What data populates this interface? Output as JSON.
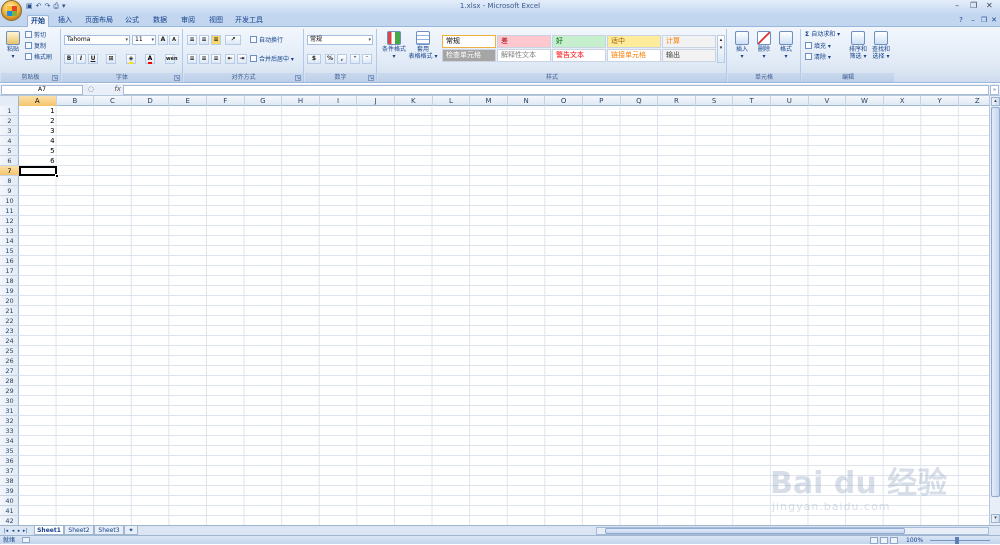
{
  "title_bar": {
    "window_title": "1.xlsx - Microsoft Excel",
    "qat": [
      "save-icon",
      "undo-icon",
      "redo-icon",
      "print-preview-icon",
      "customize-icon"
    ]
  },
  "tabs": [
    {
      "label": "开始",
      "active": true
    },
    {
      "label": "插入"
    },
    {
      "label": "页面布局"
    },
    {
      "label": "公式"
    },
    {
      "label": "数据"
    },
    {
      "label": "审阅"
    },
    {
      "label": "视图"
    },
    {
      "label": "开发工具"
    }
  ],
  "ribbon": {
    "clipboard": {
      "label": "剪贴板",
      "paste": "粘贴",
      "cut": "剪切",
      "copy": "复制",
      "format_painter": "格式刷"
    },
    "font": {
      "label": "字体",
      "font_name": "Tahoma",
      "font_size": "11",
      "grow": "A",
      "shrink": "A",
      "bold": "B",
      "italic": "I",
      "underline": "U",
      "font_color_letter": "A",
      "wen": "wén"
    },
    "alignment": {
      "label": "对齐方式",
      "wrap_text": "自动换行",
      "merge_center": "合并后居中"
    },
    "number": {
      "label": "数字",
      "format": "常规",
      "percent": "%",
      "comma": ","
    },
    "styles": {
      "label": "样式",
      "conditional": "条件格式",
      "table_format_1": "套用",
      "table_format_2": "表格格式",
      "cells": [
        {
          "text": "常规",
          "bg": "#ffffff",
          "color": "#000000",
          "border": "#f0b040"
        },
        {
          "text": "差",
          "bg": "#ffc7ce",
          "color": "#9c0006"
        },
        {
          "text": "好",
          "bg": "#c6efce",
          "color": "#006100"
        },
        {
          "text": "适中",
          "bg": "#ffeb9c",
          "color": "#9c6500"
        },
        {
          "text": "计算",
          "bg": "#f2f2f2",
          "color": "#fa7d00"
        },
        {
          "text": "检查单元格",
          "bg": "#a5a5a5",
          "color": "#ffffff"
        },
        {
          "text": "解释性文本",
          "bg": "#ffffff",
          "color": "#7f7f7f"
        },
        {
          "text": "警告文本",
          "bg": "#ffffff",
          "color": "#ff0000"
        },
        {
          "text": "链接单元格",
          "bg": "#ffffff",
          "color": "#fa7d00"
        },
        {
          "text": "输出",
          "bg": "#f2f2f2",
          "color": "#3f3f3f"
        }
      ]
    },
    "cells_group": {
      "label": "单元格",
      "insert": "插入",
      "delete": "删除",
      "format": "格式"
    },
    "editing": {
      "label": "编辑",
      "autosum": "自动求和",
      "fill": "填充",
      "clear": "清除",
      "sort_filter_1": "排序和",
      "sort_filter_2": "筛选",
      "find_select_1": "查找和",
      "find_select_2": "选择"
    }
  },
  "formula_bar": {
    "name_box": "A7",
    "fx": "fx",
    "value": ""
  },
  "grid": {
    "columns": [
      "A",
      "B",
      "C",
      "D",
      "E",
      "F",
      "G",
      "H",
      "I",
      "J",
      "K",
      "L",
      "M",
      "N",
      "O",
      "P",
      "Q",
      "R",
      "S",
      "T",
      "U",
      "V",
      "W",
      "X",
      "Y",
      "Z"
    ],
    "rows": [
      "1",
      "2",
      "3",
      "4",
      "5",
      "6",
      "7",
      "8",
      "9",
      "10",
      "11",
      "12",
      "13",
      "14",
      "15",
      "16",
      "17",
      "18",
      "19",
      "20",
      "21",
      "22",
      "23",
      "24",
      "25",
      "26",
      "27",
      "28",
      "29",
      "30",
      "31",
      "32",
      "33",
      "34",
      "35",
      "36",
      "37",
      "38",
      "39",
      "40",
      "41",
      "42"
    ],
    "active_cell": "A7",
    "column_a_values": [
      "1",
      "2",
      "3",
      "4",
      "5",
      "6"
    ]
  },
  "sheets": [
    {
      "name": "Sheet1",
      "active": true
    },
    {
      "name": "Sheet2"
    },
    {
      "name": "Sheet3"
    }
  ],
  "status": {
    "mode": "就绪",
    "zoom": "100%"
  },
  "watermark": {
    "brand": "Bai du 经验",
    "url": "jingyan.baidu.com"
  }
}
